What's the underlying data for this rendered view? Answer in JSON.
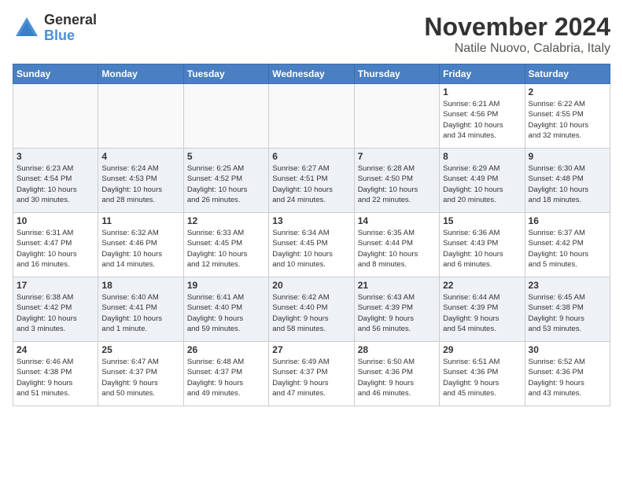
{
  "header": {
    "logo_general": "General",
    "logo_blue": "Blue",
    "month_title": "November 2024",
    "location": "Natile Nuovo, Calabria, Italy"
  },
  "days_of_week": [
    "Sunday",
    "Monday",
    "Tuesday",
    "Wednesday",
    "Thursday",
    "Friday",
    "Saturday"
  ],
  "weeks": [
    [
      {
        "day": "",
        "info": ""
      },
      {
        "day": "",
        "info": ""
      },
      {
        "day": "",
        "info": ""
      },
      {
        "day": "",
        "info": ""
      },
      {
        "day": "",
        "info": ""
      },
      {
        "day": "1",
        "info": "Sunrise: 6:21 AM\nSunset: 4:56 PM\nDaylight: 10 hours\nand 34 minutes."
      },
      {
        "day": "2",
        "info": "Sunrise: 6:22 AM\nSunset: 4:55 PM\nDaylight: 10 hours\nand 32 minutes."
      }
    ],
    [
      {
        "day": "3",
        "info": "Sunrise: 6:23 AM\nSunset: 4:54 PM\nDaylight: 10 hours\nand 30 minutes."
      },
      {
        "day": "4",
        "info": "Sunrise: 6:24 AM\nSunset: 4:53 PM\nDaylight: 10 hours\nand 28 minutes."
      },
      {
        "day": "5",
        "info": "Sunrise: 6:25 AM\nSunset: 4:52 PM\nDaylight: 10 hours\nand 26 minutes."
      },
      {
        "day": "6",
        "info": "Sunrise: 6:27 AM\nSunset: 4:51 PM\nDaylight: 10 hours\nand 24 minutes."
      },
      {
        "day": "7",
        "info": "Sunrise: 6:28 AM\nSunset: 4:50 PM\nDaylight: 10 hours\nand 22 minutes."
      },
      {
        "day": "8",
        "info": "Sunrise: 6:29 AM\nSunset: 4:49 PM\nDaylight: 10 hours\nand 20 minutes."
      },
      {
        "day": "9",
        "info": "Sunrise: 6:30 AM\nSunset: 4:48 PM\nDaylight: 10 hours\nand 18 minutes."
      }
    ],
    [
      {
        "day": "10",
        "info": "Sunrise: 6:31 AM\nSunset: 4:47 PM\nDaylight: 10 hours\nand 16 minutes."
      },
      {
        "day": "11",
        "info": "Sunrise: 6:32 AM\nSunset: 4:46 PM\nDaylight: 10 hours\nand 14 minutes."
      },
      {
        "day": "12",
        "info": "Sunrise: 6:33 AM\nSunset: 4:45 PM\nDaylight: 10 hours\nand 12 minutes."
      },
      {
        "day": "13",
        "info": "Sunrise: 6:34 AM\nSunset: 4:45 PM\nDaylight: 10 hours\nand 10 minutes."
      },
      {
        "day": "14",
        "info": "Sunrise: 6:35 AM\nSunset: 4:44 PM\nDaylight: 10 hours\nand 8 minutes."
      },
      {
        "day": "15",
        "info": "Sunrise: 6:36 AM\nSunset: 4:43 PM\nDaylight: 10 hours\nand 6 minutes."
      },
      {
        "day": "16",
        "info": "Sunrise: 6:37 AM\nSunset: 4:42 PM\nDaylight: 10 hours\nand 5 minutes."
      }
    ],
    [
      {
        "day": "17",
        "info": "Sunrise: 6:38 AM\nSunset: 4:42 PM\nDaylight: 10 hours\nand 3 minutes."
      },
      {
        "day": "18",
        "info": "Sunrise: 6:40 AM\nSunset: 4:41 PM\nDaylight: 10 hours\nand 1 minute."
      },
      {
        "day": "19",
        "info": "Sunrise: 6:41 AM\nSunset: 4:40 PM\nDaylight: 9 hours\nand 59 minutes."
      },
      {
        "day": "20",
        "info": "Sunrise: 6:42 AM\nSunset: 4:40 PM\nDaylight: 9 hours\nand 58 minutes."
      },
      {
        "day": "21",
        "info": "Sunrise: 6:43 AM\nSunset: 4:39 PM\nDaylight: 9 hours\nand 56 minutes."
      },
      {
        "day": "22",
        "info": "Sunrise: 6:44 AM\nSunset: 4:39 PM\nDaylight: 9 hours\nand 54 minutes."
      },
      {
        "day": "23",
        "info": "Sunrise: 6:45 AM\nSunset: 4:38 PM\nDaylight: 9 hours\nand 53 minutes."
      }
    ],
    [
      {
        "day": "24",
        "info": "Sunrise: 6:46 AM\nSunset: 4:38 PM\nDaylight: 9 hours\nand 51 minutes."
      },
      {
        "day": "25",
        "info": "Sunrise: 6:47 AM\nSunset: 4:37 PM\nDaylight: 9 hours\nand 50 minutes."
      },
      {
        "day": "26",
        "info": "Sunrise: 6:48 AM\nSunset: 4:37 PM\nDaylight: 9 hours\nand 49 minutes."
      },
      {
        "day": "27",
        "info": "Sunrise: 6:49 AM\nSunset: 4:37 PM\nDaylight: 9 hours\nand 47 minutes."
      },
      {
        "day": "28",
        "info": "Sunrise: 6:50 AM\nSunset: 4:36 PM\nDaylight: 9 hours\nand 46 minutes."
      },
      {
        "day": "29",
        "info": "Sunrise: 6:51 AM\nSunset: 4:36 PM\nDaylight: 9 hours\nand 45 minutes."
      },
      {
        "day": "30",
        "info": "Sunrise: 6:52 AM\nSunset: 4:36 PM\nDaylight: 9 hours\nand 43 minutes."
      }
    ]
  ]
}
